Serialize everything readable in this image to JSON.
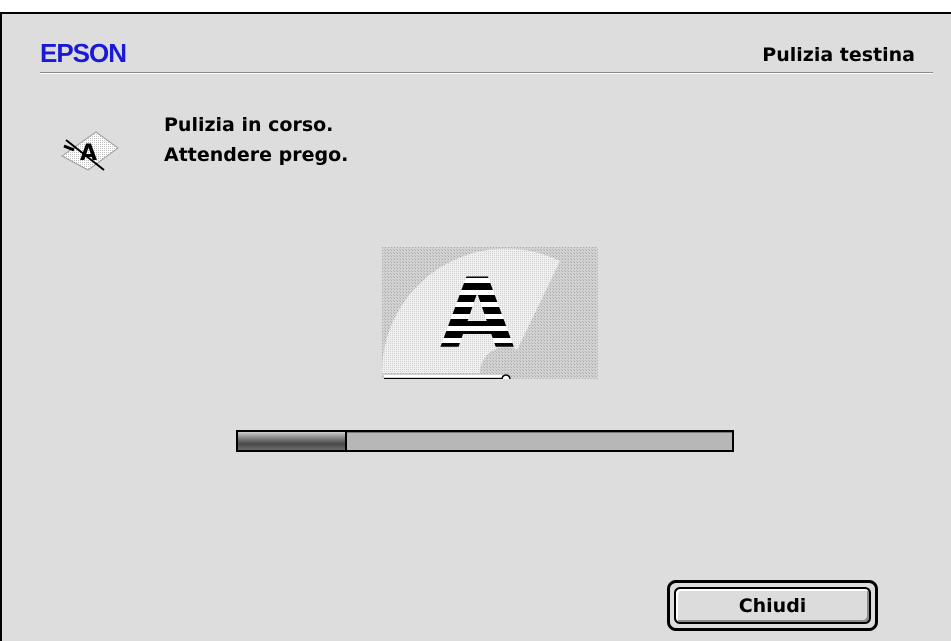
{
  "header": {
    "brand": "EPSON",
    "title": "Pulizia testina"
  },
  "message": {
    "line1": "Pulizia in corso.",
    "line2": "Attendere prego."
  },
  "progress": {
    "fraction": 0.22
  },
  "buttons": {
    "close_label": "Chiudi"
  },
  "colors": {
    "brand": "#1a1ad6",
    "dialog_bg": "#dddddd"
  },
  "icons": {
    "small": "head-cleaning-icon",
    "large": "head-cleaning-illustration"
  }
}
